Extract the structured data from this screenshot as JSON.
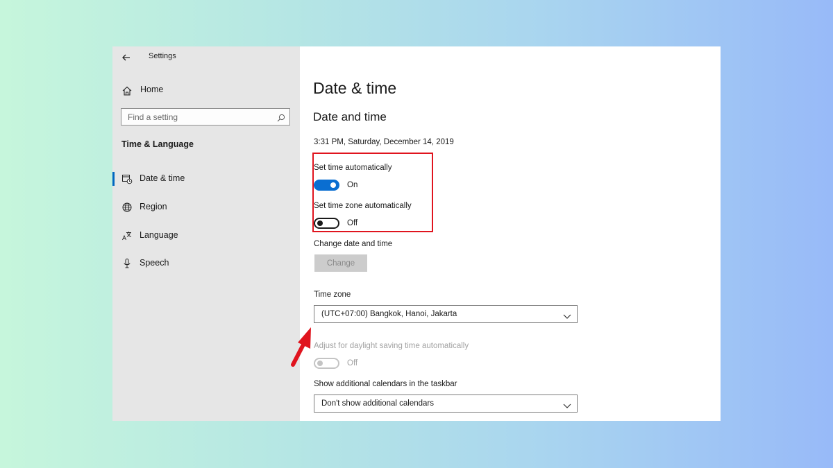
{
  "window": {
    "title": "Settings"
  },
  "sidebar": {
    "home_label": "Home",
    "search_placeholder": "Find a setting",
    "section_heading": "Time & Language",
    "items": [
      {
        "label": "Date & time",
        "icon": "calendar-clock-icon",
        "selected": true
      },
      {
        "label": "Region",
        "icon": "globe-icon",
        "selected": false
      },
      {
        "label": "Language",
        "icon": "language-icon",
        "selected": false
      },
      {
        "label": "Speech",
        "icon": "microphone-icon",
        "selected": false
      }
    ]
  },
  "main": {
    "page_title": "Date & time",
    "section_title": "Date and time",
    "current_datetime": "3:31 PM, Saturday, December 14, 2019",
    "set_time_auto": {
      "label": "Set time automatically",
      "state": "On"
    },
    "set_timezone_auto": {
      "label": "Set time zone automatically",
      "state": "Off"
    },
    "change_datetime": {
      "label": "Change date and time",
      "button": "Change"
    },
    "time_zone": {
      "label": "Time zone",
      "value": "(UTC+07:00) Bangkok, Hanoi, Jakarta"
    },
    "daylight": {
      "label": "Adjust for daylight saving time automatically",
      "state": "Off"
    },
    "calendars": {
      "label": "Show additional calendars in the taskbar",
      "value": "Don't show additional calendars"
    }
  },
  "colors": {
    "accent": "#0a6ed1",
    "highlight": "#e0141e",
    "sidebar_bg": "#e6e6e6"
  }
}
